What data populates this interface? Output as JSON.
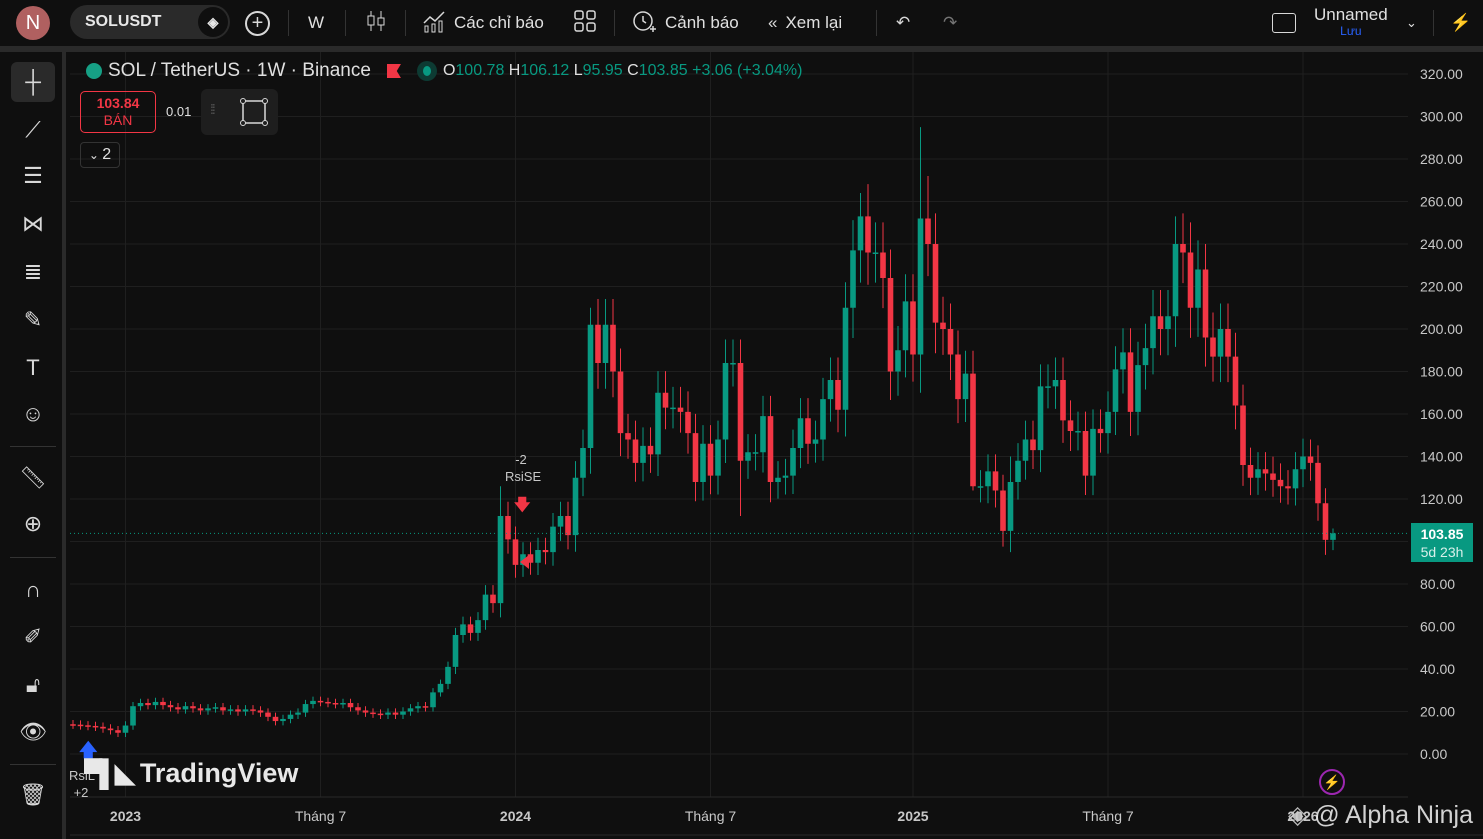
{
  "topbar": {
    "avatar_letter": "N",
    "symbol": "SOLUSDT",
    "interval": "W",
    "indicators_label": "Các chỉ báo",
    "alerts_label": "Cảnh báo",
    "replay_label": "Xem lại",
    "layout_name": "Unnamed",
    "save_label": "Lưu"
  },
  "legend": {
    "title": "SOL / TetherUS · 1W · Binance",
    "o_label": "O",
    "o": "100.78",
    "h_label": "H",
    "h": "106.12",
    "l_label": "L",
    "l": "95.95",
    "c_label": "C",
    "c": "103.85",
    "change": "+3.06 (+3.04%)"
  },
  "trade": {
    "sell_price": "103.84",
    "sell_label": "BÁN",
    "qty": "0.01",
    "collapsed_count": "2"
  },
  "price_label": {
    "price": "103.85",
    "countdown": "5d 23h"
  },
  "annotations": {
    "rsise_value": "-2",
    "rsise_label": "RsiSE",
    "rsile_label": "RsiL",
    "rsile_value": "+2"
  },
  "watermarks": {
    "logo": "TradingView",
    "credit": "@ Alpha Ninja"
  },
  "colors": {
    "up": "#089981",
    "down": "#f23645",
    "background": "#0f0f0f",
    "accent": "#2962ff"
  },
  "chart_data": {
    "type": "candlestick",
    "title": "SOL / TetherUS · 1W · Binance",
    "ylim": [
      -20,
      330
    ],
    "y_ticks": [
      "320.00",
      "300.00",
      "280.00",
      "260.00",
      "240.00",
      "220.00",
      "200.00",
      "180.00",
      "160.00",
      "140.00",
      "120.00",
      "100.00",
      "80.00",
      "60.00",
      "40.00",
      "20.00",
      "0.00"
    ],
    "y_tick_values": [
      320,
      300,
      280,
      260,
      240,
      220,
      200,
      180,
      160,
      140,
      120,
      100,
      80,
      60,
      40,
      20,
      0
    ],
    "x_ticks": [
      {
        "label": "2023",
        "index": 7,
        "bold": true
      },
      {
        "label": "Tháng 7",
        "index": 33,
        "bold": false
      },
      {
        "label": "2024",
        "index": 59,
        "bold": true
      },
      {
        "label": "Tháng 7",
        "index": 85,
        "bold": false
      },
      {
        "label": "2025",
        "index": 112,
        "bold": true
      },
      {
        "label": "Tháng 7",
        "index": 138,
        "bold": false
      },
      {
        "label": "2026",
        "index": 164,
        "bold": true
      }
    ],
    "first_open": 14.0,
    "closes": [
      13.8,
      13.5,
      13.2,
      12.8,
      12.0,
      11.2,
      10.0,
      13.4,
      22.5,
      24.0,
      23.0,
      24.5,
      23.0,
      22.0,
      21.0,
      22.5,
      21.5,
      20.5,
      21.5,
      22.0,
      20.5,
      21.0,
      20.0,
      21.0,
      20.5,
      19.5,
      17.5,
      15.5,
      16.5,
      18.5,
      19.5,
      23.5,
      25.0,
      24.5,
      24.0,
      23.5,
      24.0,
      22.0,
      20.5,
      19.5,
      19.0,
      18.5,
      19.5,
      18.5,
      20.0,
      21.5,
      22.5,
      22,
      29,
      33,
      41,
      56,
      61,
      57,
      63,
      75,
      71,
      112,
      101,
      89,
      94,
      90,
      96,
      95,
      107,
      112,
      103,
      130,
      144,
      202,
      184,
      202,
      180,
      151,
      148,
      137,
      145,
      141,
      170,
      163,
      163,
      161,
      151,
      128,
      146,
      131,
      148,
      184,
      184,
      138,
      142,
      142,
      159,
      128,
      130,
      131,
      144,
      158,
      146,
      148,
      167,
      176,
      162,
      210,
      237,
      253,
      236,
      236,
      224,
      180,
      190,
      213,
      188,
      252,
      240,
      203,
      200,
      188,
      167,
      179,
      126,
      126,
      133,
      124,
      105,
      128,
      138,
      148,
      143,
      173,
      173,
      176,
      157,
      152,
      152,
      131,
      153,
      151,
      161,
      181,
      189,
      161,
      183,
      191,
      206,
      200,
      206,
      240,
      236,
      210,
      228,
      196,
      187,
      200,
      187,
      164,
      136,
      130,
      134,
      132,
      129,
      126,
      125,
      134,
      140,
      137,
      118,
      100.78,
      103.85
    ],
    "high_overrides": {
      "57": 126,
      "69": 210,
      "103": 222,
      "105": 264,
      "113": 295,
      "114": 272,
      "125": 140,
      "147": 253,
      "151": 240,
      "165": 148
    },
    "low_overrides": {
      "113": 170,
      "125": 95,
      "120": 124,
      "89": 112
    },
    "last_candle": {
      "open": 100.78,
      "high": 106.12,
      "low": 95.95,
      "close": 103.85
    },
    "current_price": 103.85
  }
}
